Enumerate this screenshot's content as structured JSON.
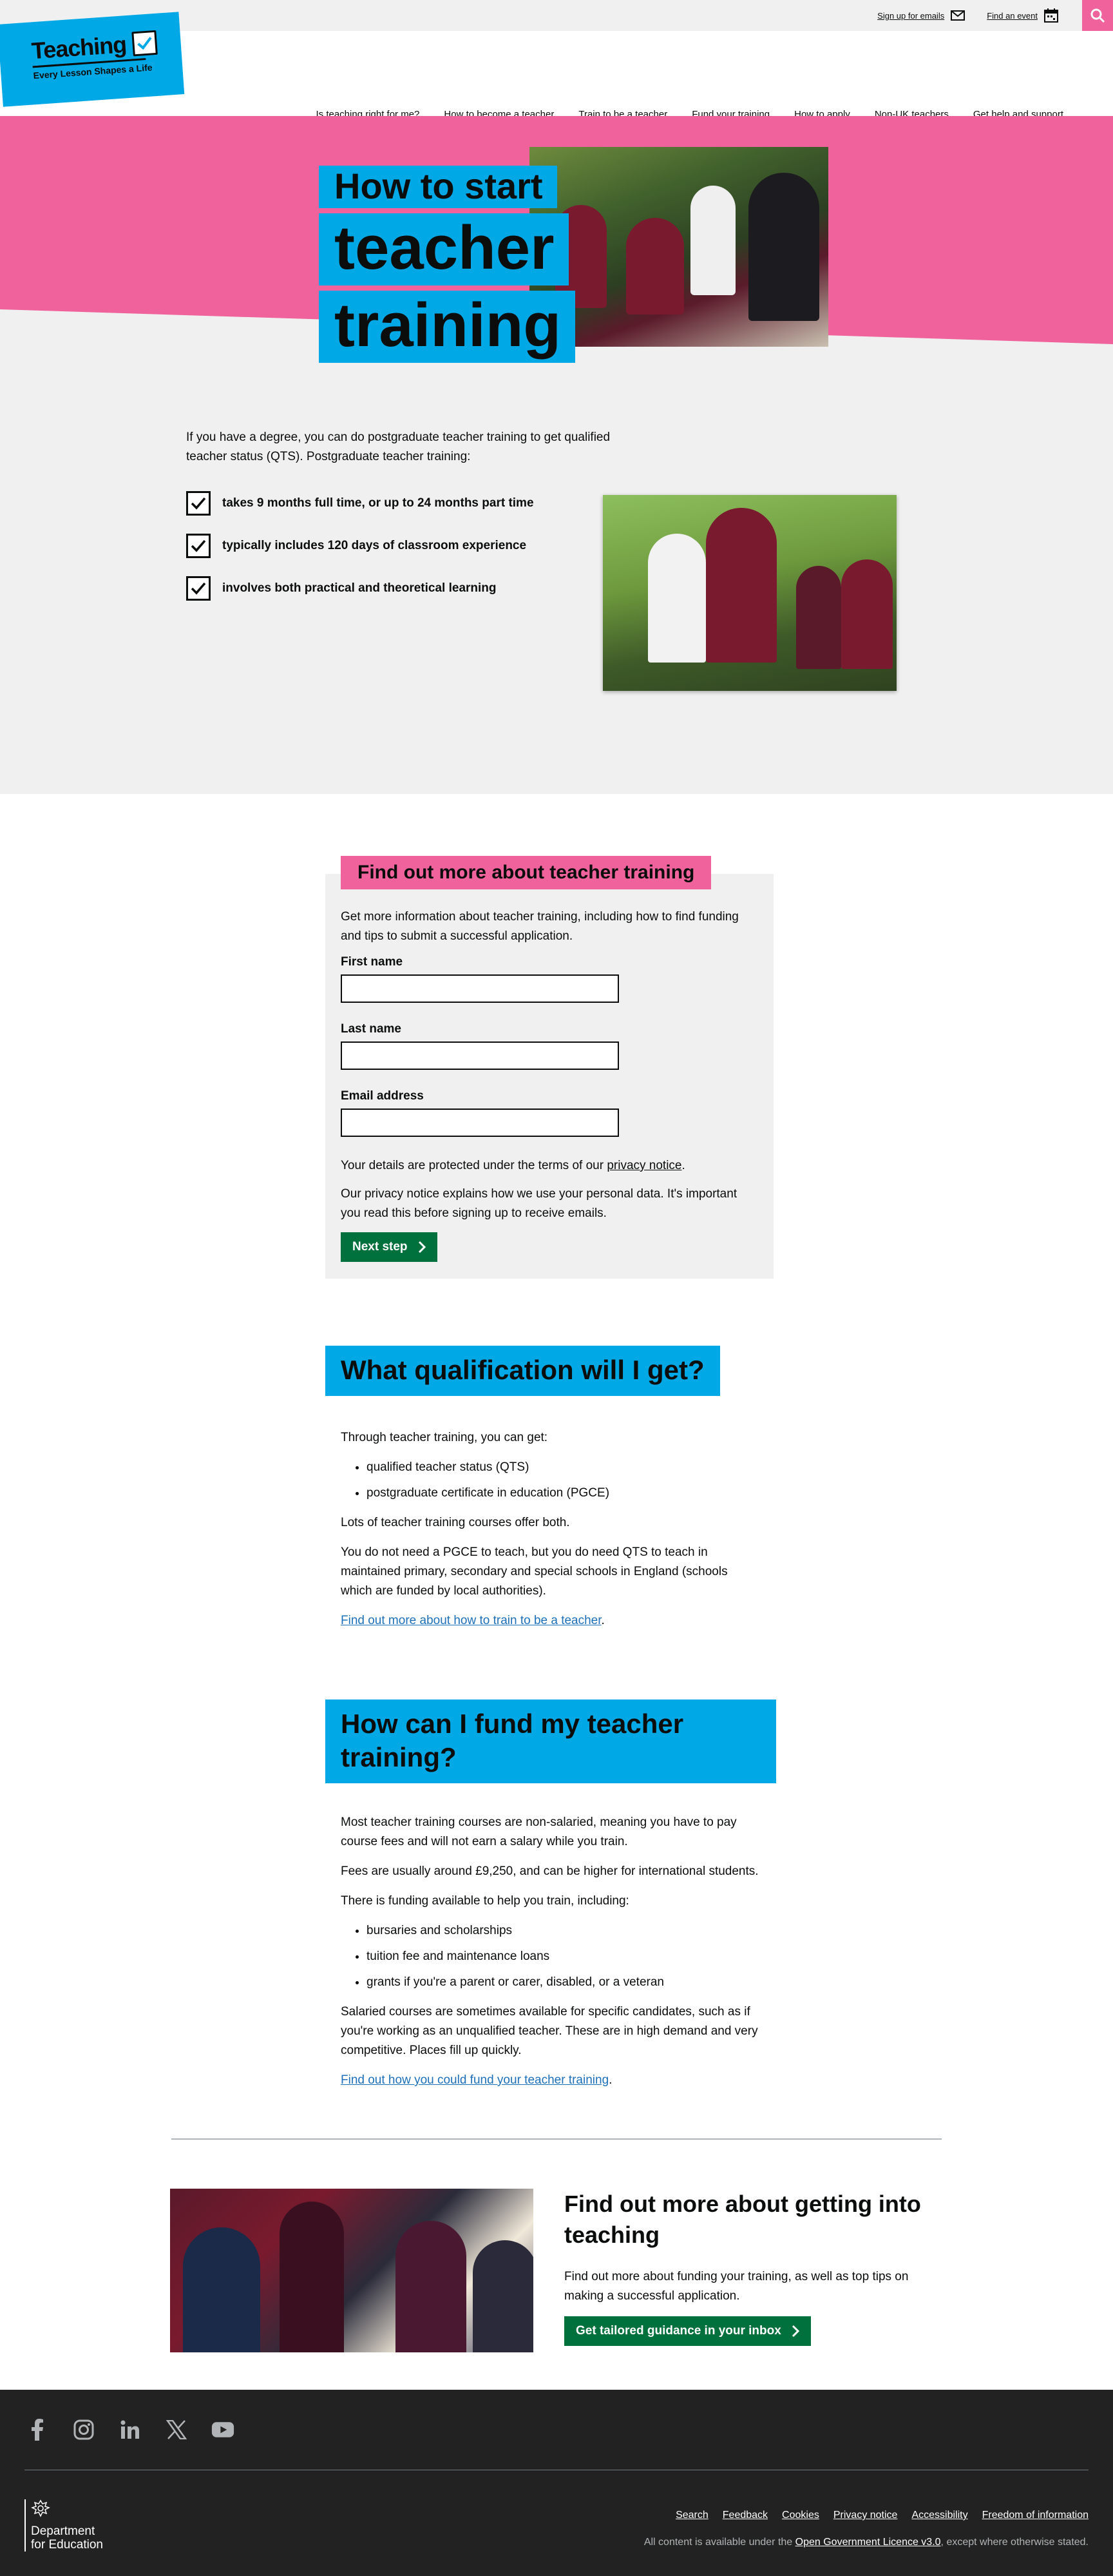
{
  "topbar": {
    "signup_label": "Sign up for emails",
    "event_label": "Find an event"
  },
  "logo": {
    "title": "Teaching",
    "strapline": "Every Lesson Shapes a Life"
  },
  "nav": {
    "items": [
      {
        "label": "Is teaching right for me?"
      },
      {
        "label": "How to become a teacher"
      },
      {
        "label": "Train to be a teacher"
      },
      {
        "label": "Fund your training"
      },
      {
        "label": "How to apply"
      },
      {
        "label": "Non-UK teachers"
      },
      {
        "label": "Get help and support"
      }
    ]
  },
  "hero": {
    "title_line1": "How to start",
    "title_line2": "teacher",
    "title_line3": "training",
    "intro": "If you have a degree, you can do postgraduate teacher training to get qualified teacher status (QTS). Postgraduate teacher training:",
    "checks": [
      {
        "text": "takes 9 months full time, or up to 24 months part time"
      },
      {
        "text": "typically includes 120 days of classroom experience"
      },
      {
        "text": "involves both practical and theoretical learning"
      }
    ]
  },
  "form": {
    "heading": "Find out more about teacher training",
    "intro": "Get more information about teacher training, including how to find funding and tips to submit a successful application.",
    "first_name_label": "First name",
    "last_name_label": "Last name",
    "email_label": "Email address",
    "privacy_prefix": "Your details are protected under the terms of our ",
    "privacy_link": "privacy notice",
    "privacy_suffix": ".",
    "privacy_note": "Our privacy notice explains how we use your personal data. It's important you read this before signing up to receive emails.",
    "submit_label": "Next step"
  },
  "qualification": {
    "heading": "What qualification will I get?",
    "intro": "Through teacher training, you can get:",
    "items": [
      {
        "text": "qualified teacher status (QTS)"
      },
      {
        "text": "postgraduate certificate in education (PGCE)"
      }
    ],
    "p1": "Lots of teacher training courses offer both.",
    "p2": "You do not need a PGCE to teach, but you do need QTS to teach in maintained primary, secondary and special schools in England (schools which are funded by local authorities).",
    "link": "Find out more about how to train to be a teacher",
    "link_suffix": "."
  },
  "funding": {
    "heading": "How can I fund my teacher training?",
    "p1": "Most teacher training courses are non-salaried, meaning you have to pay course fees and will not earn a salary while you train.",
    "p2": "Fees are usually around £9,250, and can be higher for international students.",
    "p3": "There is funding available to help you train, including:",
    "items": [
      {
        "text": "bursaries and scholarships"
      },
      {
        "text": "tuition fee and maintenance loans"
      },
      {
        "text": "grants if you're a parent or carer, disabled, or a veteran"
      }
    ],
    "p4": "Salaried courses are sometimes available for specific candidates, such as if you're working as an unqualified teacher. These are in high demand and very competitive. Places fill up quickly.",
    "link": "Find out how you could fund your teacher training",
    "link_suffix": "."
  },
  "cta": {
    "title": "Find out more about getting into teaching",
    "desc": "Find out more about funding your training, as well as top tips on making a successful application.",
    "button": "Get tailored guidance in your inbox"
  },
  "footer": {
    "dept_line1": "Department",
    "dept_line2": "for Education",
    "links": [
      {
        "label": "Search"
      },
      {
        "label": "Feedback"
      },
      {
        "label": "Cookies"
      },
      {
        "label": "Privacy notice"
      },
      {
        "label": "Accessibility"
      },
      {
        "label": "Freedom of information"
      }
    ],
    "licence_prefix": "All content is available under the ",
    "licence_link": "Open Government Licence v3.0",
    "licence_suffix": ", except where otherwise stated."
  },
  "colors": {
    "brand_blue": "#00a8e6",
    "brand_pink": "#f0629b",
    "button_green": "#00703c",
    "footer_bg": "#222222"
  }
}
